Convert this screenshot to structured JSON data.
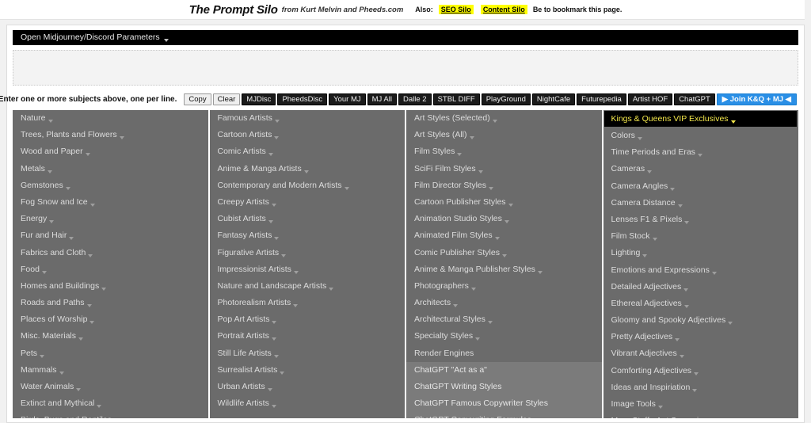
{
  "header": {
    "brand": "The Prompt Silo",
    "byline": "from Kurt Melvin and Pheeds.com",
    "also_label": "Also:",
    "link_seo": "SEO Silo",
    "link_content": "Content Silo",
    "bookmark_text": "Be to bookmark this page.",
    "highlight_color": "#ffff00"
  },
  "params_bar": {
    "label": "Open Midjourney/Discord Parameters",
    "background": "#000000",
    "text_color": "#e8e8e8"
  },
  "subject_input": {
    "value": "",
    "placeholder": ""
  },
  "toolbar": {
    "hint": "Enter one or more subjects above, one per line.",
    "buttons": [
      {
        "label": "Copy",
        "style": "plain"
      },
      {
        "label": "Clear",
        "style": "plain"
      },
      {
        "label": "MJDisc",
        "style": "dark"
      },
      {
        "label": "PheedsDisc",
        "style": "dark"
      },
      {
        "label": "Your MJ",
        "style": "dark"
      },
      {
        "label": "MJ All",
        "style": "dark"
      },
      {
        "label": "Dalle 2",
        "style": "dark"
      },
      {
        "label": "STBL DIFF",
        "style": "dark"
      },
      {
        "label": "PlayGround",
        "style": "dark"
      },
      {
        "label": "NightCafe",
        "style": "dark"
      },
      {
        "label": "Futurepedia",
        "style": "dark"
      },
      {
        "label": "Artist HOF",
        "style": "dark"
      },
      {
        "label": "ChatGPT",
        "style": "dark"
      },
      {
        "label": "▶ Join K&Q + MJ ◀",
        "style": "blue"
      }
    ]
  },
  "menu": {
    "columns": [
      {
        "name": "subjects",
        "items": [
          {
            "label": "Nature",
            "caret": true,
            "style": "normal"
          },
          {
            "label": "Trees, Plants and Flowers",
            "caret": true,
            "style": "normal"
          },
          {
            "label": "Wood and Paper",
            "caret": true,
            "style": "normal"
          },
          {
            "label": "Metals",
            "caret": true,
            "style": "normal"
          },
          {
            "label": "Gemstones",
            "caret": true,
            "style": "normal"
          },
          {
            "label": "Fog Snow and Ice",
            "caret": true,
            "style": "normal"
          },
          {
            "label": "Energy",
            "caret": true,
            "style": "normal"
          },
          {
            "label": "Fur and Hair",
            "caret": true,
            "style": "normal"
          },
          {
            "label": "Fabrics and Cloth",
            "caret": true,
            "style": "normal"
          },
          {
            "label": "Food",
            "caret": true,
            "style": "normal"
          },
          {
            "label": "Homes and Buildings",
            "caret": true,
            "style": "normal"
          },
          {
            "label": "Roads and Paths",
            "caret": true,
            "style": "normal"
          },
          {
            "label": "Places of Worship",
            "caret": true,
            "style": "normal"
          },
          {
            "label": "Misc. Materials",
            "caret": true,
            "style": "normal"
          },
          {
            "label": "Pets",
            "caret": true,
            "style": "normal"
          },
          {
            "label": "Mammals",
            "caret": true,
            "style": "normal"
          },
          {
            "label": "Water Animals",
            "caret": true,
            "style": "normal"
          },
          {
            "label": "Extinct and Mythical",
            "caret": true,
            "style": "normal"
          },
          {
            "label": "Birds, Bugs and Reptiles",
            "caret": true,
            "style": "normal"
          }
        ]
      },
      {
        "name": "artists",
        "items": [
          {
            "label": "Famous Artists",
            "caret": true,
            "style": "normal"
          },
          {
            "label": "Cartoon Artists",
            "caret": true,
            "style": "normal"
          },
          {
            "label": "Comic Artists",
            "caret": true,
            "style": "normal"
          },
          {
            "label": "Anime & Manga Artists",
            "caret": true,
            "style": "normal"
          },
          {
            "label": "Contemporary and Modern Artists",
            "caret": true,
            "style": "normal"
          },
          {
            "label": "Creepy Artists",
            "caret": true,
            "style": "normal"
          },
          {
            "label": "Cubist Artists",
            "caret": true,
            "style": "normal"
          },
          {
            "label": "Fantasy Artists",
            "caret": true,
            "style": "normal"
          },
          {
            "label": "Figurative Artists",
            "caret": true,
            "style": "normal"
          },
          {
            "label": "Impressionist Artists",
            "caret": true,
            "style": "normal"
          },
          {
            "label": "Nature and Landscape Artists",
            "caret": true,
            "style": "normal"
          },
          {
            "label": "Photorealism Artists",
            "caret": true,
            "style": "normal"
          },
          {
            "label": "Pop Art Artists",
            "caret": true,
            "style": "normal"
          },
          {
            "label": "Portrait Artists",
            "caret": true,
            "style": "normal"
          },
          {
            "label": "Still Life Artists",
            "caret": true,
            "style": "normal"
          },
          {
            "label": "Surrealist Artists",
            "caret": true,
            "style": "normal"
          },
          {
            "label": "Urban Artists",
            "caret": true,
            "style": "normal"
          },
          {
            "label": "Wildlife Artists",
            "caret": true,
            "style": "normal"
          }
        ]
      },
      {
        "name": "styles",
        "items": [
          {
            "label": "Art Styles (Selected)",
            "caret": true,
            "style": "normal"
          },
          {
            "label": "Art Styles (All)",
            "caret": true,
            "style": "normal"
          },
          {
            "label": "Film Styles",
            "caret": true,
            "style": "normal"
          },
          {
            "label": "SciFi Film Styles",
            "caret": true,
            "style": "normal"
          },
          {
            "label": "Film Director Styles",
            "caret": true,
            "style": "normal"
          },
          {
            "label": "Cartoon Publisher Styles",
            "caret": true,
            "style": "normal"
          },
          {
            "label": "Animation Studio Styles",
            "caret": true,
            "style": "normal"
          },
          {
            "label": "Animated Film Styles",
            "caret": true,
            "style": "normal"
          },
          {
            "label": "Comic Publisher Styles",
            "caret": true,
            "style": "normal"
          },
          {
            "label": "Anime & Manga Publisher Styles",
            "caret": true,
            "style": "normal"
          },
          {
            "label": "Photographers",
            "caret": true,
            "style": "normal"
          },
          {
            "label": "Architects",
            "caret": true,
            "style": "normal"
          },
          {
            "label": "Architectural Styles",
            "caret": true,
            "style": "normal"
          },
          {
            "label": "Specialty Styles",
            "caret": true,
            "style": "normal"
          },
          {
            "label": "Render Engines",
            "caret": false,
            "style": "normal"
          },
          {
            "label": "ChatGPT \"Act as a\"",
            "caret": false,
            "style": "light"
          },
          {
            "label": "ChatGPT Writing Styles",
            "caret": false,
            "style": "light"
          },
          {
            "label": "ChatGPT Famous Copywriter Styles",
            "caret": false,
            "style": "light"
          },
          {
            "label": "ChatGPT Copywriting Formulas",
            "caret": false,
            "style": "light"
          }
        ]
      },
      {
        "name": "modifiers",
        "items": [
          {
            "label": "Kings & Queens VIP Exclusives",
            "caret": true,
            "style": "vip"
          },
          {
            "label": "Colors",
            "caret": true,
            "style": "normal"
          },
          {
            "label": "Time Periods and Eras",
            "caret": true,
            "style": "normal"
          },
          {
            "label": "Cameras",
            "caret": true,
            "style": "normal"
          },
          {
            "label": "Camera Angles",
            "caret": true,
            "style": "normal"
          },
          {
            "label": "Camera Distance",
            "caret": true,
            "style": "normal"
          },
          {
            "label": "Lenses F1 & Pixels",
            "caret": true,
            "style": "normal"
          },
          {
            "label": "Film Stock",
            "caret": true,
            "style": "normal"
          },
          {
            "label": "Lighting",
            "caret": true,
            "style": "normal"
          },
          {
            "label": "Emotions and Expressions",
            "caret": true,
            "style": "normal"
          },
          {
            "label": "Detailed Adjectives",
            "caret": true,
            "style": "normal"
          },
          {
            "label": "Ethereal Adjectives",
            "caret": true,
            "style": "normal"
          },
          {
            "label": "Gloomy and Spooky Adjectives",
            "caret": true,
            "style": "normal"
          },
          {
            "label": "Pretty Adjectives",
            "caret": true,
            "style": "normal"
          },
          {
            "label": "Vibrant Adjectives",
            "caret": true,
            "style": "normal"
          },
          {
            "label": "Comforting Adjectives",
            "caret": true,
            "style": "normal"
          },
          {
            "label": "Ideas and Inspiriation",
            "caret": true,
            "style": "normal"
          },
          {
            "label": "Image Tools",
            "caret": true,
            "style": "normal"
          },
          {
            "label": "More Stuff - Ant Surveying",
            "caret": true,
            "style": "normal"
          }
        ]
      }
    ]
  }
}
